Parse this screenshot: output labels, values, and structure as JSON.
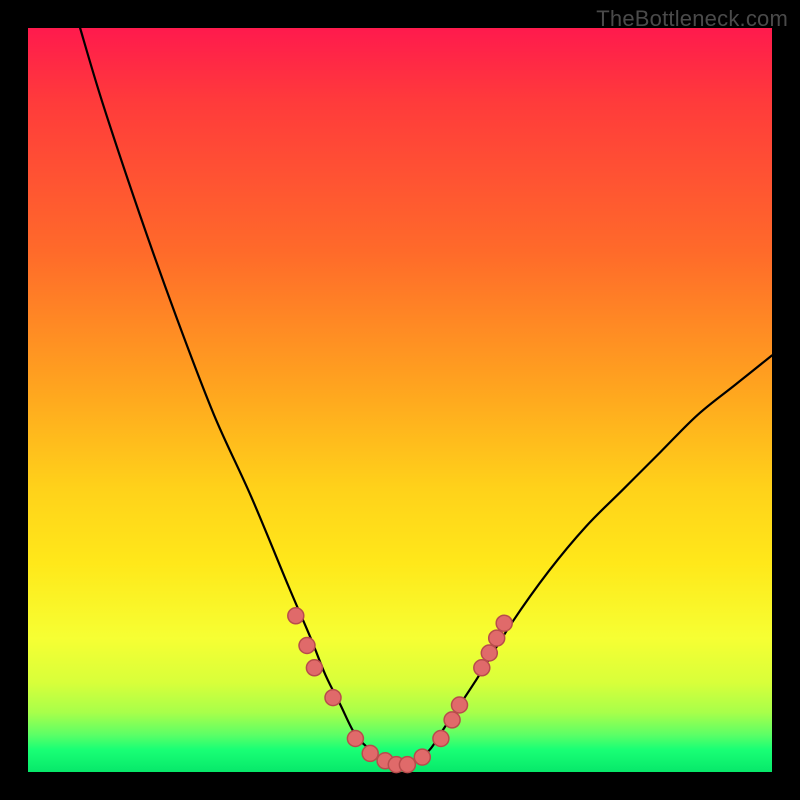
{
  "watermark": "TheBottleneck.com",
  "chart_data": {
    "type": "line",
    "title": "",
    "xlabel": "",
    "ylabel": "",
    "xlim": [
      0,
      100
    ],
    "ylim": [
      0,
      100
    ],
    "grid": false,
    "legend": false,
    "series": [
      {
        "name": "bottleneck-curve",
        "x": [
          7,
          10,
          15,
          20,
          25,
          30,
          35,
          38,
          40,
          42,
          44,
          46,
          48,
          50,
          52,
          54,
          56,
          60,
          65,
          70,
          75,
          80,
          85,
          90,
          95,
          100
        ],
        "y": [
          100,
          90,
          75,
          61,
          48,
          37,
          25,
          18,
          13,
          9,
          5,
          3,
          1.5,
          1,
          1.5,
          3,
          6,
          12,
          20,
          27,
          33,
          38,
          43,
          48,
          52,
          56
        ]
      }
    ],
    "markers": {
      "name": "highlighted-points",
      "x": [
        36,
        37.5,
        38.5,
        41,
        44,
        46,
        48,
        49.5,
        51,
        53,
        55.5,
        57,
        58,
        61,
        62,
        63,
        64
      ],
      "y": [
        21,
        17,
        14,
        10,
        4.5,
        2.5,
        1.5,
        1,
        1,
        2,
        4.5,
        7,
        9,
        14,
        16,
        18,
        20
      ]
    },
    "background_gradient": {
      "top": "#ff1a4d",
      "upper_mid": "#ffa31f",
      "lower_mid": "#ffe81a",
      "bottom": "#07e86a"
    }
  }
}
